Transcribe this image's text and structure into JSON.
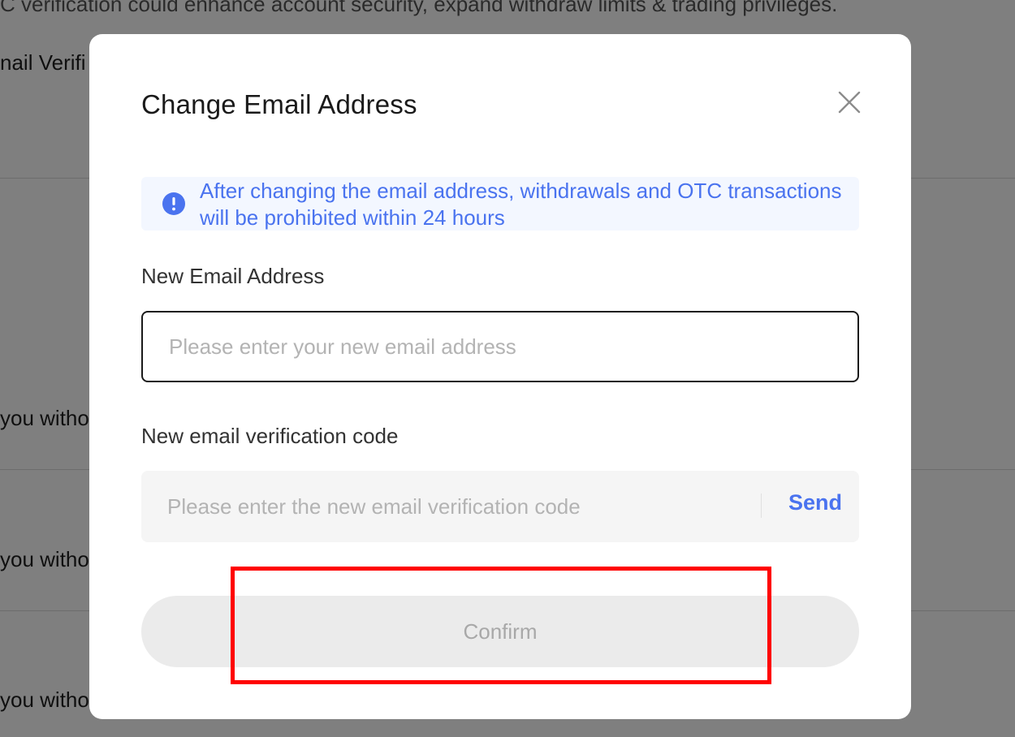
{
  "background": {
    "banner_text": "C verification could enhance account security, expand withdraw limits & trading privileges.",
    "email_row_label": "nail Verifi",
    "row_texts": [
      "you witho",
      "you witho",
      "you witho"
    ]
  },
  "modal": {
    "title": "Change Email Address",
    "notice_text": "After changing the email address, withdrawals and OTC transactions will be prohibited within 24 hours",
    "email_label": "New Email Address",
    "email_placeholder": "Please enter your new email address",
    "code_label": "New email verification code",
    "code_placeholder": "Please enter the new email verification code",
    "send_label": "Send",
    "confirm_label": "Confirm"
  },
  "icons": {
    "close": "close-icon",
    "notice": "info-icon"
  },
  "colors": {
    "accent": "#4a73ef",
    "notice_bg": "#f3f7ff",
    "confirm_disabled_bg": "#ebebeb",
    "highlight": "#ff0000"
  }
}
